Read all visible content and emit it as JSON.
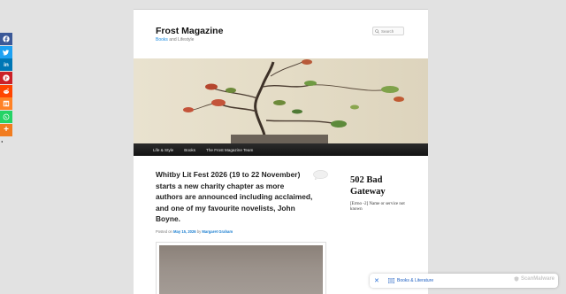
{
  "site": {
    "title": "Frost Magazine",
    "tagline_link": "Books",
    "tagline_rest": " and Lifestyle"
  },
  "search": {
    "placeholder": "Search"
  },
  "nav": {
    "items": [
      {
        "label": "Life & Style"
      },
      {
        "label": "Books"
      },
      {
        "label": "The Frost Magazine Team"
      }
    ]
  },
  "post": {
    "title": "Whitby Lit Fest 2026 (19 to 22 November) starts a new charity chapter as more authors are announced including acclaimed, and one of my favourite novelists, John Boyne.",
    "meta_prefix": "Posted on ",
    "date": "May 15, 2026",
    "meta_by": " by ",
    "author": "Margaret Graham"
  },
  "sidebar": {
    "widget_title": "502 Bad Gateway",
    "widget_body": "[Errno -2] Name or service not known"
  },
  "share": {
    "buttons": [
      {
        "name": "facebook",
        "color": "#3b5998",
        "glyph": "f"
      },
      {
        "name": "twitter",
        "color": "#1da1f2",
        "glyph": "t"
      },
      {
        "name": "linkedin",
        "color": "#0077b5",
        "glyph": "in"
      },
      {
        "name": "pinterest",
        "color": "#cb2027",
        "glyph": "P"
      },
      {
        "name": "reddit",
        "color": "#ff4500",
        "glyph": "r"
      },
      {
        "name": "mix",
        "color": "#ff8226",
        "glyph": "m"
      },
      {
        "name": "whatsapp",
        "color": "#25d366",
        "glyph": "w"
      },
      {
        "name": "more",
        "color": "#f17c1f",
        "glyph": "+"
      }
    ],
    "toggle_glyph": "◂"
  },
  "bottom_bar": {
    "close_glyph": "✕",
    "label": "Books & Literature",
    "brand": "ScanMalware"
  }
}
